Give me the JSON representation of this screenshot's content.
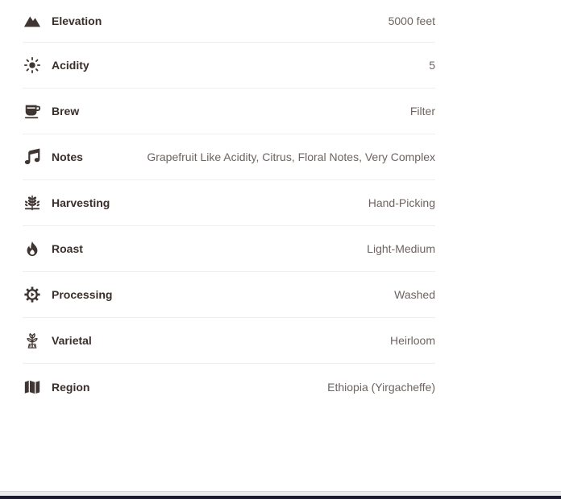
{
  "colors": {
    "icon": "#3f3532",
    "label": "#3a2e2a",
    "value": "#6e6360",
    "divider": "#eeeeee"
  },
  "specs": [
    {
      "icon": "mountain-icon",
      "label": "Elevation",
      "value": "5000 feet"
    },
    {
      "icon": "sun-icon",
      "label": "Acidity",
      "value": "5"
    },
    {
      "icon": "coffee-cup-icon",
      "label": "Brew",
      "value": "Filter"
    },
    {
      "icon": "music-note-icon",
      "label": "Notes",
      "value": "Grapefruit Like Acidity, Citrus, Floral Notes, Very Complex"
    },
    {
      "icon": "wheat-icon",
      "label": "Harvesting",
      "value": "Hand-Picking"
    },
    {
      "icon": "flame-icon",
      "label": "Roast",
      "value": "Light-Medium"
    },
    {
      "icon": "gear-icon",
      "label": "Processing",
      "value": "Washed"
    },
    {
      "icon": "plant-icon",
      "label": "Varietal",
      "value": "Heirloom"
    },
    {
      "icon": "map-icon",
      "label": "Region",
      "value": "Ethiopia (Yirgacheffe)"
    }
  ]
}
